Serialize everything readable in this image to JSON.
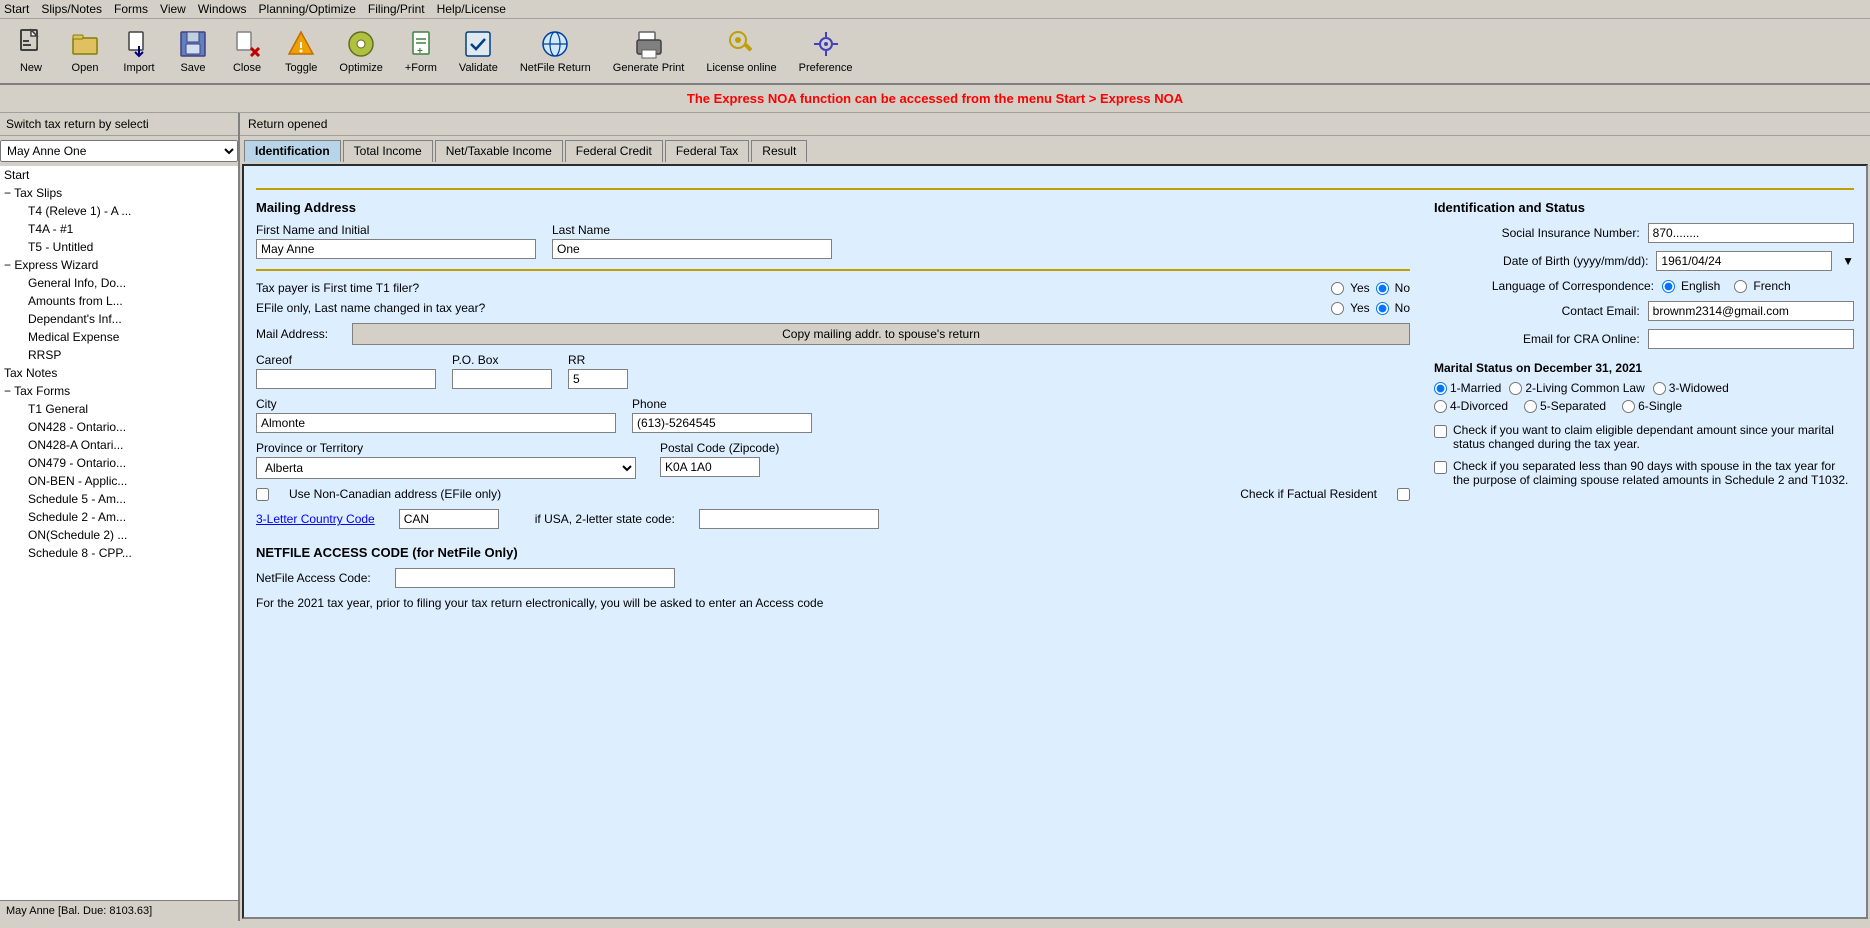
{
  "menubar": {
    "items": [
      "Start",
      "Slips/Notes",
      "Forms",
      "View",
      "Windows",
      "Planning/Optimize",
      "Filing/Print",
      "Help/License"
    ]
  },
  "toolbar": {
    "buttons": [
      {
        "id": "new",
        "label": "New",
        "icon": "🗋"
      },
      {
        "id": "open",
        "label": "Open",
        "icon": "🗂"
      },
      {
        "id": "import",
        "label": "Import",
        "icon": "📥"
      },
      {
        "id": "save",
        "label": "Save",
        "icon": "💾"
      },
      {
        "id": "close",
        "label": "Close",
        "icon": "✖"
      },
      {
        "id": "toggle",
        "label": "Toggle",
        "icon": "⚡"
      },
      {
        "id": "optimize",
        "label": "Optimize",
        "icon": "⚙"
      },
      {
        "id": "form",
        "label": "+Form",
        "icon": "📄"
      },
      {
        "id": "validate",
        "label": "Validate",
        "icon": "✔"
      },
      {
        "id": "netfile",
        "label": "NetFile Return",
        "icon": "🌐"
      },
      {
        "id": "generate",
        "label": "Generate Print",
        "icon": "🖨"
      },
      {
        "id": "license",
        "label": "License online",
        "icon": "🔑"
      },
      {
        "id": "preference",
        "label": "Preference",
        "icon": "⚙"
      }
    ]
  },
  "noa_banner": "The Express NOA function can be accessed from the menu Start > Express NOA",
  "left_panel": {
    "header": "Switch tax return by selecti",
    "select_value": "May Anne One",
    "tree": [
      {
        "label": "Start",
        "level": 0
      },
      {
        "label": "Tax Slips",
        "level": 0,
        "expand": "−"
      },
      {
        "label": "T4 (Releve 1) - A ...",
        "level": 2
      },
      {
        "label": "T4A - #1",
        "level": 2
      },
      {
        "label": "T5 - Untitled",
        "level": 2
      },
      {
        "label": "Express Wizard",
        "level": 0,
        "expand": "−"
      },
      {
        "label": "General Info, Do...",
        "level": 2
      },
      {
        "label": "Amounts from L...",
        "level": 2
      },
      {
        "label": "Dependant's Inf...",
        "level": 2
      },
      {
        "label": "Medical Expense",
        "level": 2
      },
      {
        "label": "RRSP",
        "level": 2
      },
      {
        "label": "Tax Notes",
        "level": 0
      },
      {
        "label": "Tax Forms",
        "level": 0,
        "expand": "−"
      },
      {
        "label": "T1 General",
        "level": 2
      },
      {
        "label": "ON428 - Ontario...",
        "level": 2
      },
      {
        "label": "ON428-A Ontari...",
        "level": 2
      },
      {
        "label": "ON479 - Ontario...",
        "level": 2
      },
      {
        "label": "ON-BEN - Applic...",
        "level": 2
      },
      {
        "label": "Schedule 5 - Am...",
        "level": 2
      },
      {
        "label": "Schedule 2 - Am...",
        "level": 2
      },
      {
        "label": "ON(Schedule 2) ...",
        "level": 2
      },
      {
        "label": "Schedule 8 - CPP...",
        "level": 2
      }
    ],
    "status": "May Anne [Bal. Due: 8103.63]"
  },
  "main": {
    "return_opened": "Return opened",
    "tabs": [
      "Identification",
      "Total Income",
      "Net/Taxable Income",
      "Federal Credit",
      "Federal Tax",
      "Result"
    ],
    "active_tab": "Identification"
  },
  "form": {
    "mailing_address_header": "Mailing Address",
    "first_name_label": "First Name and Initial",
    "last_name_label": "Last Name",
    "first_name_value": "May Anne",
    "last_name_value": "One",
    "filer_question": "Tax payer is First time T1 filer?",
    "efile_question": "EFile only, Last name changed in tax year?",
    "filer_yes": "Yes",
    "filer_no": "No",
    "efile_yes": "Yes",
    "efile_no": "No",
    "mail_address_label": "Mail Address:",
    "copy_btn_label": "Copy mailing addr. to spouse's return",
    "careof_label": "Careof",
    "pobox_label": "P.O. Box",
    "rr_label": "RR",
    "rr_value": "5",
    "city_label": "City",
    "phone_label": "Phone",
    "city_value": "Almonte",
    "phone_value": "(613)-5264545",
    "province_label": "Province or Territory",
    "postal_label": "Postal Code (Zipcode)",
    "province_value": "Alberta",
    "postal_value": "K0A 1A0",
    "use_noncad_label": "Use Non-Canadian address (EFile only)",
    "factual_resident_label": "Check if Factual Resident",
    "country_code_label": "3-Letter Country Code",
    "country_code_value": "CAN",
    "usa_state_label": "if USA, 2-letter state code:",
    "id_status_header": "Identification and Status",
    "sin_label": "Social Insurance Number:",
    "sin_value": "870........",
    "dob_label": "Date of Birth (yyyy/mm/dd):",
    "dob_value": "1961/04/24",
    "language_label": "Language of Correspondence:",
    "language_english": "English",
    "language_french": "French",
    "contact_email_label": "Contact Email:",
    "contact_email_value": "brownm2314@gmail.com",
    "email_cra_label": "Email for CRA Online:",
    "marital_title": "Marital Status on December 31, 2021",
    "marital_options": [
      "1-Married",
      "2-Living Common Law",
      "3-Widowed",
      "4-Divorced",
      "5-Separated",
      "6-Single"
    ],
    "marital_selected": "1-Married",
    "check1_label": "Check if you want to claim eligible dependant amount since your marital status changed during the tax year.",
    "check2_label": "Check if you separated less than 90 days with spouse in the tax year for the purpose of claiming spouse related amounts in Schedule 2 and T1032.",
    "netfile_header": "NETFILE ACCESS CODE (for NetFile Only)",
    "netfile_code_label": "NetFile Access Code:",
    "netfile_note": "For the 2021 tax year, prior to filing your tax return electronically, you will be asked to enter an Access code"
  }
}
